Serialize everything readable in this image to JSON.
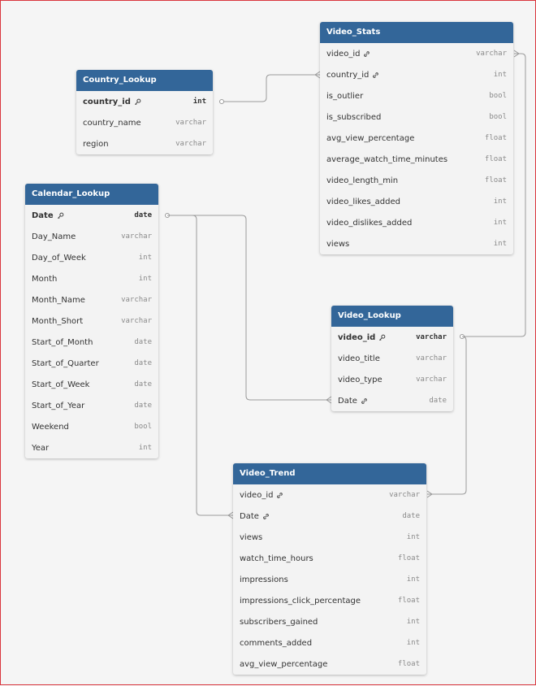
{
  "tables": {
    "video_stats": {
      "title": "Video_Stats",
      "rows": [
        {
          "name": "video_id",
          "type": "varchar"
        },
        {
          "name": "country_id",
          "type": "int"
        },
        {
          "name": "is_outlier",
          "type": "bool"
        },
        {
          "name": "is_subscribed",
          "type": "bool"
        },
        {
          "name": "avg_view_percentage",
          "type": "float"
        },
        {
          "name": "average_watch_time_minutes",
          "type": "float"
        },
        {
          "name": "video_length_min",
          "type": "float"
        },
        {
          "name": "video_likes_added",
          "type": "int"
        },
        {
          "name": "video_dislikes_added",
          "type": "int"
        },
        {
          "name": "views",
          "type": "int"
        }
      ]
    },
    "country_lookup": {
      "title": "Country_Lookup",
      "rows": [
        {
          "name": "country_id",
          "type": "int"
        },
        {
          "name": "country_name",
          "type": "varchar"
        },
        {
          "name": "region",
          "type": "varchar"
        }
      ]
    },
    "calendar_lookup": {
      "title": "Calendar_Lookup",
      "rows": [
        {
          "name": "Date",
          "type": "date"
        },
        {
          "name": "Day_Name",
          "type": "varchar"
        },
        {
          "name": "Day_of_Week",
          "type": "int"
        },
        {
          "name": "Month",
          "type": "int"
        },
        {
          "name": "Month_Name",
          "type": "varchar"
        },
        {
          "name": "Month_Short",
          "type": "varchar"
        },
        {
          "name": "Start_of_Month",
          "type": "date"
        },
        {
          "name": "Start_of_Quarter",
          "type": "date"
        },
        {
          "name": "Start_of_Week",
          "type": "date"
        },
        {
          "name": "Start_of_Year",
          "type": "date"
        },
        {
          "name": "Weekend",
          "type": "bool"
        },
        {
          "name": "Year",
          "type": "int"
        }
      ]
    },
    "video_lookup": {
      "title": "Video_Lookup",
      "rows": [
        {
          "name": "video_id",
          "type": "varchar"
        },
        {
          "name": "video_title",
          "type": "varchar"
        },
        {
          "name": "video_type",
          "type": "varchar"
        },
        {
          "name": "Date",
          "type": "date"
        }
      ]
    },
    "video_trend": {
      "title": "Video_Trend",
      "rows": [
        {
          "name": "video_id",
          "type": "varchar"
        },
        {
          "name": "Date",
          "type": "date"
        },
        {
          "name": "views",
          "type": "int"
        },
        {
          "name": "watch_time_hours",
          "type": "float"
        },
        {
          "name": "impressions",
          "type": "int"
        },
        {
          "name": "impressions_click_percentage",
          "type": "float"
        },
        {
          "name": "subscribers_gained",
          "type": "int"
        },
        {
          "name": "comments_added",
          "type": "int"
        },
        {
          "name": "avg_view_percentage",
          "type": "float"
        }
      ]
    }
  },
  "colors": {
    "header": "#336699",
    "line": "#9a9a9a"
  },
  "icons": {
    "primary_key": "key-icon",
    "foreign_key": "link-icon"
  }
}
